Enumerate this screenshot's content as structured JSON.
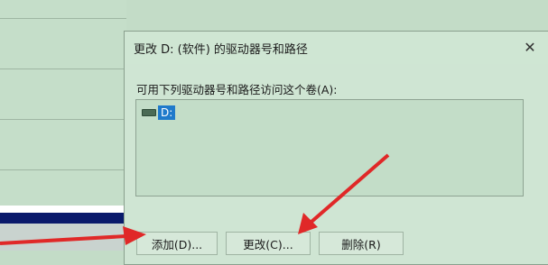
{
  "dialog": {
    "title": "更改 D: (软件) 的驱动器号和路径",
    "close_glyph": "✕",
    "instruction": "可用下列驱动器号和路径访问这个卷(A):",
    "list_items": [
      {
        "label": "D:"
      }
    ],
    "buttons": {
      "add": "添加(D)...",
      "change": "更改(C)...",
      "delete": "删除(R)"
    }
  },
  "annotations": {
    "arrow_color": "#e02828"
  }
}
